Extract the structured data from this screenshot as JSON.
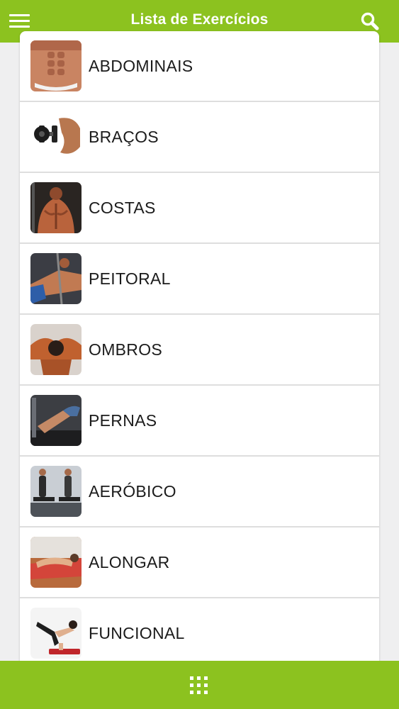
{
  "header": {
    "title": "Lista de Exercícios",
    "menu_icon": "hamburger-menu-icon",
    "search_icon": "search-icon"
  },
  "exercises": [
    {
      "label": "ABDOMINAIS",
      "icon": "abs-photo"
    },
    {
      "label": "BRAÇOS",
      "icon": "arm-dumbbell-photo"
    },
    {
      "label": "COSTAS",
      "icon": "back-muscles-photo"
    },
    {
      "label": "PEITORAL",
      "icon": "chest-press-photo"
    },
    {
      "label": "OMBROS",
      "icon": "shoulders-photo"
    },
    {
      "label": "PERNAS",
      "icon": "leg-press-photo"
    },
    {
      "label": "AERÓBICO",
      "icon": "treadmill-photo"
    },
    {
      "label": "ALONGAR",
      "icon": "stretching-photo"
    },
    {
      "label": "FUNCIONAL",
      "icon": "functional-training-photo"
    }
  ],
  "footer": {
    "icon": "grid-apps-icon"
  },
  "colors": {
    "accent": "#8cc21f",
    "background": "#efeff0",
    "card": "#ffffff",
    "divider": "#dedede",
    "text": "#1b1b1b"
  }
}
